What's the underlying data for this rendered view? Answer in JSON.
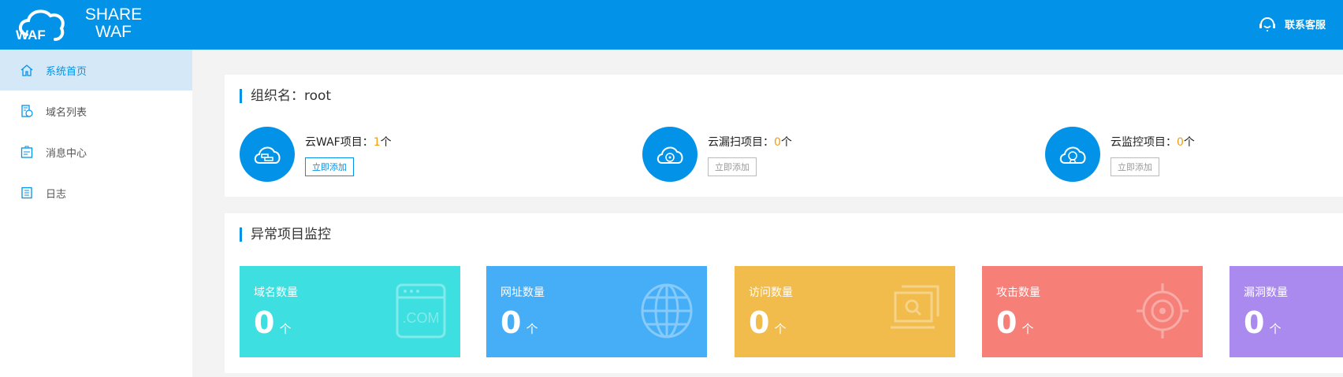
{
  "header": {
    "brand_line1": "SHARE",
    "brand_line2": "WAF",
    "logo_text": "WAF",
    "contact_label": "联系客服",
    "color": "#0293e8"
  },
  "sidebar": {
    "items": [
      {
        "label": "系统首页",
        "icon": "home-icon",
        "active": true
      },
      {
        "label": "域名列表",
        "icon": "domain-list-icon"
      },
      {
        "label": "消息中心",
        "icon": "message-icon"
      },
      {
        "label": "日志",
        "icon": "log-icon"
      }
    ]
  },
  "org": {
    "title": "组织名：root",
    "projects": [
      {
        "label": "云WAF项目：",
        "count": "1",
        "unit": "个",
        "button": "立即添加",
        "icon": "cloud-firewall-icon"
      },
      {
        "label": "云漏扫项目：",
        "count": "0",
        "unit": "个",
        "button": "立即添加",
        "icon": "cloud-scan-icon"
      },
      {
        "label": "云监控项目：",
        "count": "0",
        "unit": "个",
        "button": "立即添加",
        "icon": "cloud-camera-icon"
      }
    ]
  },
  "monitor": {
    "title": "异常项目监控",
    "tiles": [
      {
        "label": "域名数量",
        "value": "0",
        "unit": "个",
        "color": "#3ddfe0",
        "icon": "dotcom-icon",
        "icon_text": ".COM"
      },
      {
        "label": "网址数量",
        "value": "0",
        "unit": "个",
        "color": "#45aef7",
        "icon": "globe-icon"
      },
      {
        "label": "访问数量",
        "value": "0",
        "unit": "个",
        "color": "#f1bc4c",
        "icon": "search-screen-icon"
      },
      {
        "label": "攻击数量",
        "value": "0",
        "unit": "个",
        "color": "#f67f78",
        "icon": "target-icon"
      },
      {
        "label": "漏洞数量",
        "value": "0",
        "unit": "个",
        "color": "#ab8af0",
        "icon": "bug-icon"
      }
    ]
  }
}
